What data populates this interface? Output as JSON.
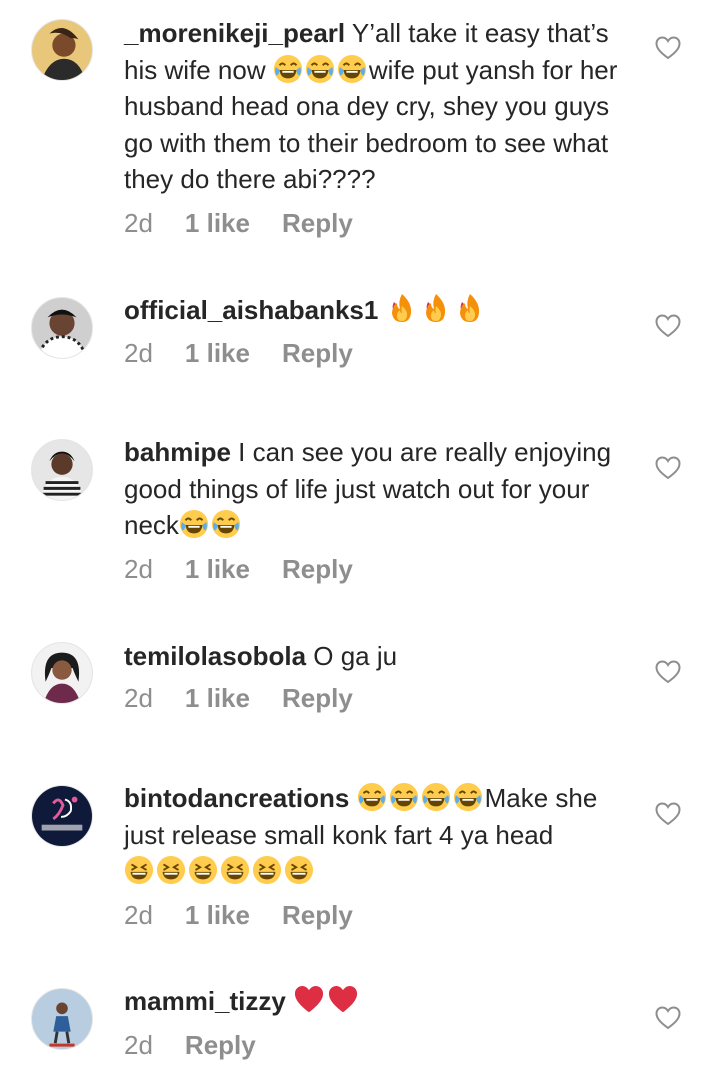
{
  "comments": [
    {
      "username": "_morenikeji_pearl",
      "text_parts": [
        " Y’all take it easy that’s his wife now ",
        "wife put yansh for her husband head ona dey cry, shey you guys go with them to their bedroom to see what they do there abi????"
      ],
      "time": "2d",
      "likes": "1 like",
      "reply": "Reply"
    },
    {
      "username": "official_aishabanks1",
      "text_parts": [
        " "
      ],
      "time": "2d",
      "likes": "1 like",
      "reply": "Reply"
    },
    {
      "username": "bahmipe",
      "text_parts": [
        " I can see you are really enjoying good things of life just watch out for your neck"
      ],
      "time": "2d",
      "likes": "1 like",
      "reply": "Reply"
    },
    {
      "username": "temilolasobola",
      "text_parts": [
        " O ga ju"
      ],
      "time": "2d",
      "likes": "1 like",
      "reply": "Reply"
    },
    {
      "username": "bintodancreations",
      "text_parts": [
        " ",
        "Make she just release small konk fart 4 ya head"
      ],
      "time": "2d",
      "likes": "1 like",
      "reply": "Reply"
    },
    {
      "username": "mammi_tizzy",
      "text_parts": [
        " "
      ],
      "time": "2d",
      "reply": "Reply"
    }
  ],
  "icons": {
    "like": "heart-outline-icon",
    "emoji_laugh": "face-with-tears-of-joy",
    "emoji_fire": "fire",
    "emoji_grin": "grinning-squinting-face",
    "emoji_heart": "red-heart"
  },
  "colors": {
    "text": "#262626",
    "meta": "#8e8e8e",
    "heart_outline": "#8e8e8e"
  }
}
